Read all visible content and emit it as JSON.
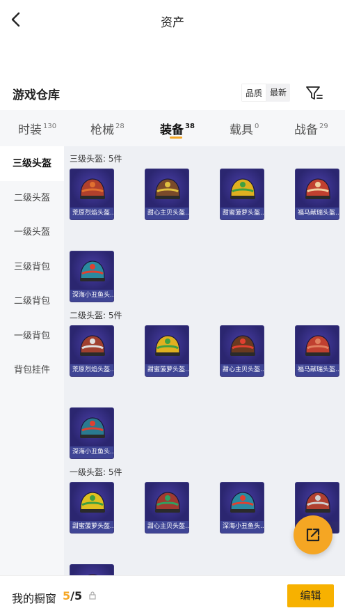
{
  "header": {
    "title": "资产"
  },
  "warehouse": {
    "title": "游戏仓库",
    "sort_options": [
      "品质",
      "最新"
    ],
    "sort_active": "品质"
  },
  "tabs": [
    {
      "label": "时装",
      "count": "130"
    },
    {
      "label": "枪械",
      "count": "28"
    },
    {
      "label": "装备",
      "count": "38",
      "active": true
    },
    {
      "label": "载具",
      "count": "0"
    },
    {
      "label": "战备",
      "count": "29"
    }
  ],
  "sidebar": [
    {
      "label": "三级头盔",
      "active": true
    },
    {
      "label": "二级头盔"
    },
    {
      "label": "一级头盔"
    },
    {
      "label": "三级背包"
    },
    {
      "label": "二级背包"
    },
    {
      "label": "一级背包"
    },
    {
      "label": "背包挂件"
    }
  ],
  "sections": [
    {
      "title": "三级头盔: 5件",
      "items": [
        {
          "name": "荒原烈焰头盔...",
          "color": "#b0402c",
          "accent": "#e07030"
        },
        {
          "name": "甜心主贝头盔...",
          "color": "#7a4a2a",
          "accent": "#e0c040"
        },
        {
          "name": "甜蜜菠萝头盔...",
          "color": "#e0b020",
          "accent": "#40a040"
        },
        {
          "name": "福马献瑞头盔...",
          "color": "#c04030",
          "accent": "#f0d0a0"
        },
        {
          "name": "深海小丑鱼头...",
          "color": "#2a8aa0",
          "accent": "#e04030"
        }
      ]
    },
    {
      "title": "二级头盔: 5件",
      "items": [
        {
          "name": "荒原烈焰头盔...",
          "color": "#a04030",
          "accent": "#e0e0e0"
        },
        {
          "name": "甜蜜菠萝头盔...",
          "color": "#e0b020",
          "accent": "#40a040"
        },
        {
          "name": "甜心主贝头盔...",
          "color": "#6a3a20",
          "accent": "#e04030"
        },
        {
          "name": "福马献瑞头盔...",
          "color": "#c04030",
          "accent": "#e08060"
        },
        {
          "name": "深海小丑鱼头...",
          "color": "#2a7a90",
          "accent": "#e04030"
        }
      ]
    },
    {
      "title": "一级头盔: 5件",
      "items": [
        {
          "name": "甜蜜菠萝头盔...",
          "color": "#e0c020",
          "accent": "#40a040"
        },
        {
          "name": "甜心主贝头盔...",
          "color": "#a03a30",
          "accent": "#30a060"
        },
        {
          "name": "深海小丑鱼头...",
          "color": "#2a8aa0",
          "accent": "#e04030"
        },
        {
          "name": "",
          "color": "#b04030",
          "accent": "#d0d0d0"
        },
        {
          "name": "",
          "color": "#c04030",
          "accent": "#e0e0e0"
        }
      ]
    }
  ],
  "bottom": {
    "cabinet_label": "我的橱窗",
    "cabinet_used": "5",
    "cabinet_total": "/5",
    "edit_label": "编辑"
  },
  "colors": {
    "accent": "#f5a623",
    "card_bg": "#2e2a6c",
    "card_label_bg": "#3f4595"
  }
}
